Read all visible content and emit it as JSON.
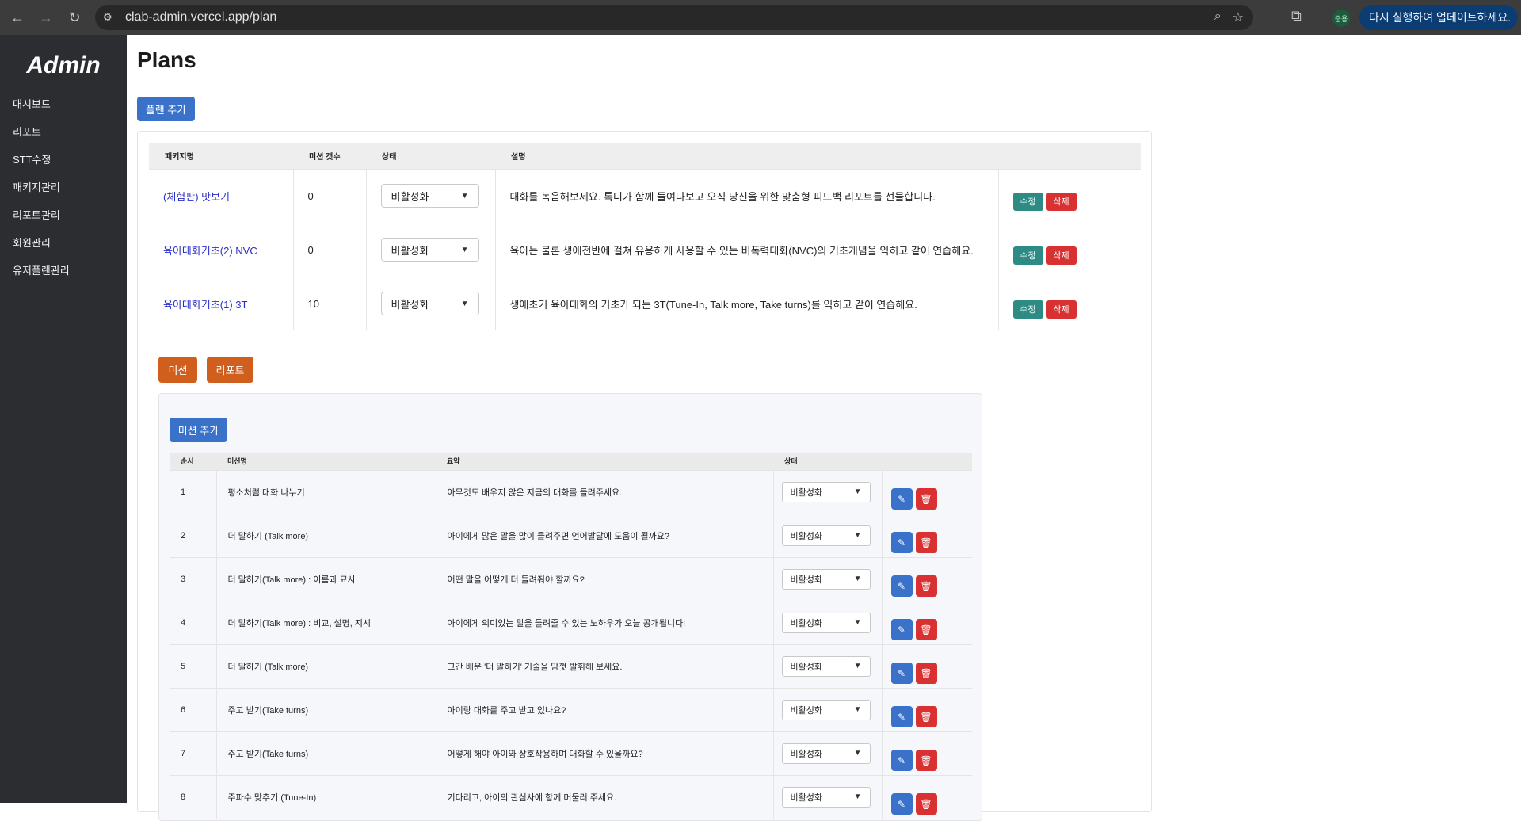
{
  "browser": {
    "url": "clab-admin.vercel.app/plan",
    "profile_label": "준용",
    "update_label": "다시 실행하여 업데이트하세요."
  },
  "sidebar": {
    "brand": "Admin",
    "items": [
      {
        "label": "대시보드"
      },
      {
        "label": "리포트"
      },
      {
        "label": "STT수정"
      },
      {
        "label": "패키지관리"
      },
      {
        "label": "리포트관리"
      },
      {
        "label": "회원관리"
      },
      {
        "label": "유저플랜관리"
      }
    ]
  },
  "page": {
    "title": "Plans",
    "add_plan_label": "플랜 추가"
  },
  "plan_table": {
    "headers": {
      "name": "패키지명",
      "mission_count": "미션 갯수",
      "status": "상태",
      "description": "설명"
    },
    "rows": [
      {
        "name": "(체험판) 맛보기",
        "count": "0",
        "status": "비활성화",
        "description": "대화를 녹음해보세요. 톡디가 함께 들여다보고 오직 당신을 위한 맞춤형 피드백 리포트를 선물합니다.",
        "edit": "수정",
        "delete": "삭제"
      },
      {
        "name": "육아대화기초(2) NVC",
        "count": "0",
        "status": "비활성화",
        "description": "육아는 물론 생애전반에 걸쳐 유용하게 사용할 수 있는 비폭력대화(NVC)의 기초개념을 익히고 같이 연습해요.",
        "edit": "수정",
        "delete": "삭제"
      },
      {
        "name": "육아대화기초(1) 3T",
        "count": "10",
        "status": "비활성화",
        "description": "생애초기 육아대화의 기초가 되는 3T(Tune-In, Talk more, Take turns)를 익히고 같이 연습해요.",
        "edit": "수정",
        "delete": "삭제"
      }
    ]
  },
  "tabs": {
    "mission": "미션",
    "report": "리포트"
  },
  "mission_panel": {
    "add_label": "미션 추가",
    "headers": {
      "order": "순서",
      "name": "미션명",
      "summary": "요약",
      "status": "상태"
    },
    "rows": [
      {
        "order": "1",
        "name": "평소처럼 대화 나누기",
        "summary": "아무것도 배우지 않은 지금의 대화를 들려주세요.",
        "status": "비활성화"
      },
      {
        "order": "2",
        "name": "더 말하기 (Talk more)",
        "summary": "아이에게 많은 말을 많이 들려주면 언어발달에 도움이 될까요?",
        "status": "비활성화"
      },
      {
        "order": "3",
        "name": "더 말하기(Talk more) : 이름과 묘사",
        "summary": "어떤 말을 어떻게 더 들려줘야 할까요?",
        "status": "비활성화"
      },
      {
        "order": "4",
        "name": "더 말하기(Talk more) : 비교, 설명, 지시",
        "summary": "아이에게 의미있는 말을 들려줄 수 있는 노하우가 오늘 공개됩니다!",
        "status": "비활성화"
      },
      {
        "order": "5",
        "name": "더 말하기 (Talk more)",
        "summary": "그간 배운 '더 말하기' 기술을 맘껏 발휘해 보세요.",
        "status": "비활성화"
      },
      {
        "order": "6",
        "name": "주고 받기(Take turns)",
        "summary": "아이랑 대화를 주고 받고 있나요?",
        "status": "비활성화"
      },
      {
        "order": "7",
        "name": "주고 받기(Take turns)",
        "summary": "어떻게 해야 아이와 상호작용하며 대화할 수 있을까요?",
        "status": "비활성화"
      },
      {
        "order": "8",
        "name": "주파수 맞추기 (Tune-In)",
        "summary": "기다리고, 아이의 관심사에 함께 머물러 주세요.",
        "status": "비활성화"
      }
    ]
  }
}
